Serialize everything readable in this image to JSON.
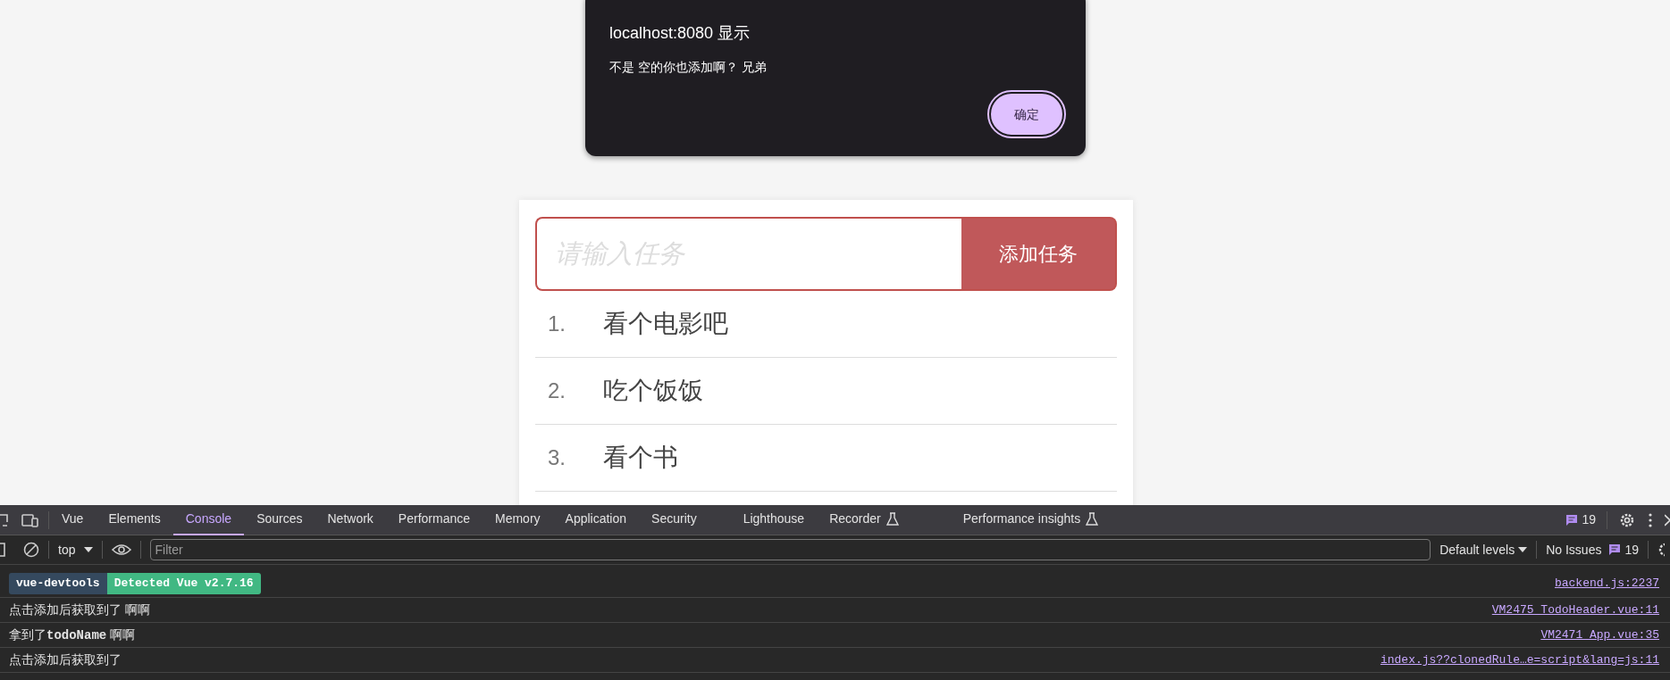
{
  "dialog": {
    "title": "localhost:8080 显示",
    "message": "不是 空的你也添加啊？ 兄弟",
    "button": "确定"
  },
  "todo": {
    "input": {
      "placeholder": "请输入任务"
    },
    "add_button": "添加任务",
    "items": [
      {
        "number": "1.",
        "text": "看个电影吧"
      },
      {
        "number": "2.",
        "text": "吃个饭饭"
      },
      {
        "number": "3.",
        "text": "看个书"
      }
    ]
  },
  "devtools": {
    "tabs": [
      {
        "label": "Vue",
        "selected": false,
        "experimental": false
      },
      {
        "label": "Elements",
        "selected": false,
        "experimental": false
      },
      {
        "label": "Console",
        "selected": true,
        "experimental": false
      },
      {
        "label": "Sources",
        "selected": false,
        "experimental": false
      },
      {
        "label": "Network",
        "selected": false,
        "experimental": false
      },
      {
        "label": "Performance",
        "selected": false,
        "experimental": false
      },
      {
        "label": "Memory",
        "selected": false,
        "experimental": false
      },
      {
        "label": "Application",
        "selected": false,
        "experimental": false
      },
      {
        "label": "Security",
        "selected": false,
        "experimental": false
      },
      {
        "label": "Lighthouse",
        "selected": false,
        "experimental": false
      },
      {
        "label": "Recorder",
        "selected": false,
        "experimental": true
      },
      {
        "label": "Performance insights",
        "selected": false,
        "experimental": true
      }
    ],
    "messages_count": "19",
    "toolbar": {
      "context": "top",
      "filter": {
        "placeholder": "Filter"
      },
      "levels": "Default levels",
      "issues_label": "No Issues",
      "issues_count": "19"
    },
    "console": [
      {
        "kind": "badges",
        "badges": [
          {
            "text": "vue-devtools",
            "color": "#35495e"
          },
          {
            "text": "Detected Vue v2.7.16",
            "color": "#41b883"
          }
        ],
        "source": "backend.js:2237"
      },
      {
        "kind": "log",
        "text": "点击添加后获取到了 啊啊",
        "source": "VM2475 TodoHeader.vue:11"
      },
      {
        "kind": "log",
        "text": "拿到了**todoName** 啊啊",
        "source": "VM2471 App.vue:35"
      },
      {
        "kind": "log",
        "text": "点击添加后获取到了",
        "source": "index.js??clonedRule…e=script&lang=js:11"
      }
    ]
  }
}
